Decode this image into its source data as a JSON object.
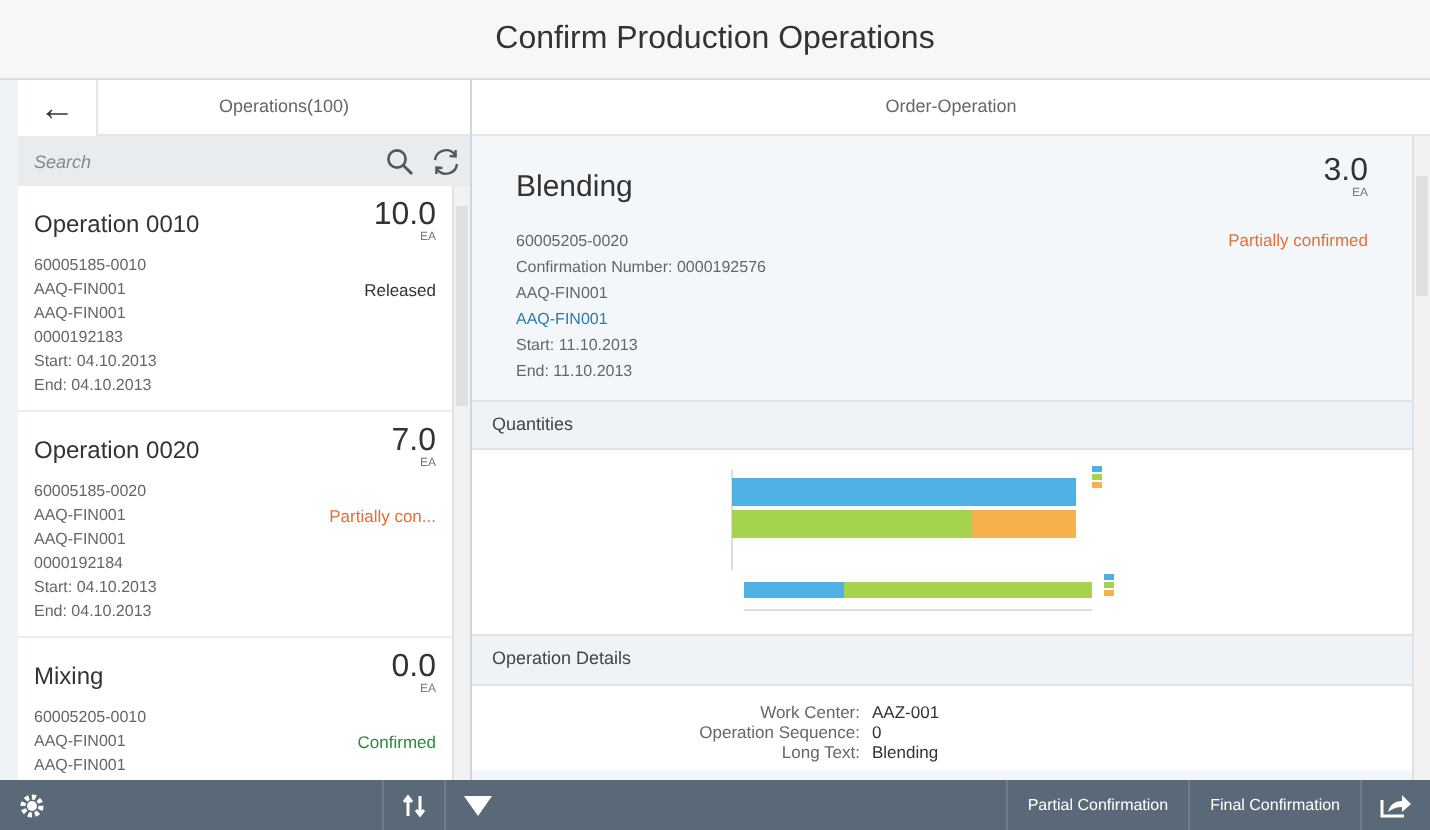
{
  "window": {
    "title": "Confirm Production Operations"
  },
  "master": {
    "back_label": "←",
    "title": "Operations(100)",
    "search": {
      "placeholder": "Search"
    },
    "items": [
      {
        "title": "Operation 0010",
        "quantity": "10.0",
        "unit": "EA",
        "status": "Released",
        "kind": "released",
        "selected": false,
        "lines": [
          "60005185-0010",
          "AAQ-FIN001",
          "AAQ-FIN001",
          "0000192183",
          "Start: 04.10.2013",
          "End: 04.10.2013"
        ]
      },
      {
        "title": "Operation 0020",
        "quantity": "7.0",
        "unit": "EA",
        "status": "Partially con...",
        "kind": "partial",
        "selected": false,
        "lines": [
          "60005185-0020",
          "AAQ-FIN001",
          "AAQ-FIN001",
          "0000192184",
          "Start: 04.10.2013",
          "End: 04.10.2013"
        ]
      },
      {
        "title": "Mixing",
        "quantity": "0.0",
        "unit": "EA",
        "status": "Confirmed",
        "kind": "confirmed",
        "selected": false,
        "lines": [
          "60005205-0010",
          "AAQ-FIN001",
          "AAQ-FIN001"
        ]
      }
    ]
  },
  "detail": {
    "title": "Order-Operation",
    "header": {
      "title": "Blending",
      "quantity": "3.0",
      "unit": "EA",
      "status": "Partially confirmed",
      "kind": "partial",
      "lines": [
        {
          "text": "60005205-0020",
          "kind": "text"
        },
        {
          "text": "Confirmation Number: 0000192576",
          "kind": "text"
        },
        {
          "text": "AAQ-FIN001",
          "kind": "text"
        },
        {
          "text": "AAQ-FIN001",
          "kind": "link"
        },
        {
          "text": "Start: 11.10.2013",
          "kind": "text"
        },
        {
          "text": "End: 11.10.2013",
          "kind": "text"
        }
      ]
    },
    "quantities": {
      "title": "Quantities"
    },
    "operation_details": {
      "title": "Operation Details",
      "fields": [
        {
          "label": "Work Center:",
          "value": "AAZ-001"
        },
        {
          "label": "Operation Sequence:",
          "value": "0"
        },
        {
          "label": "Long Text:",
          "value": "Blending"
        }
      ]
    }
  },
  "footer": {
    "buttons": [
      "Partial Confirmation",
      "Final Confirmation"
    ]
  }
}
